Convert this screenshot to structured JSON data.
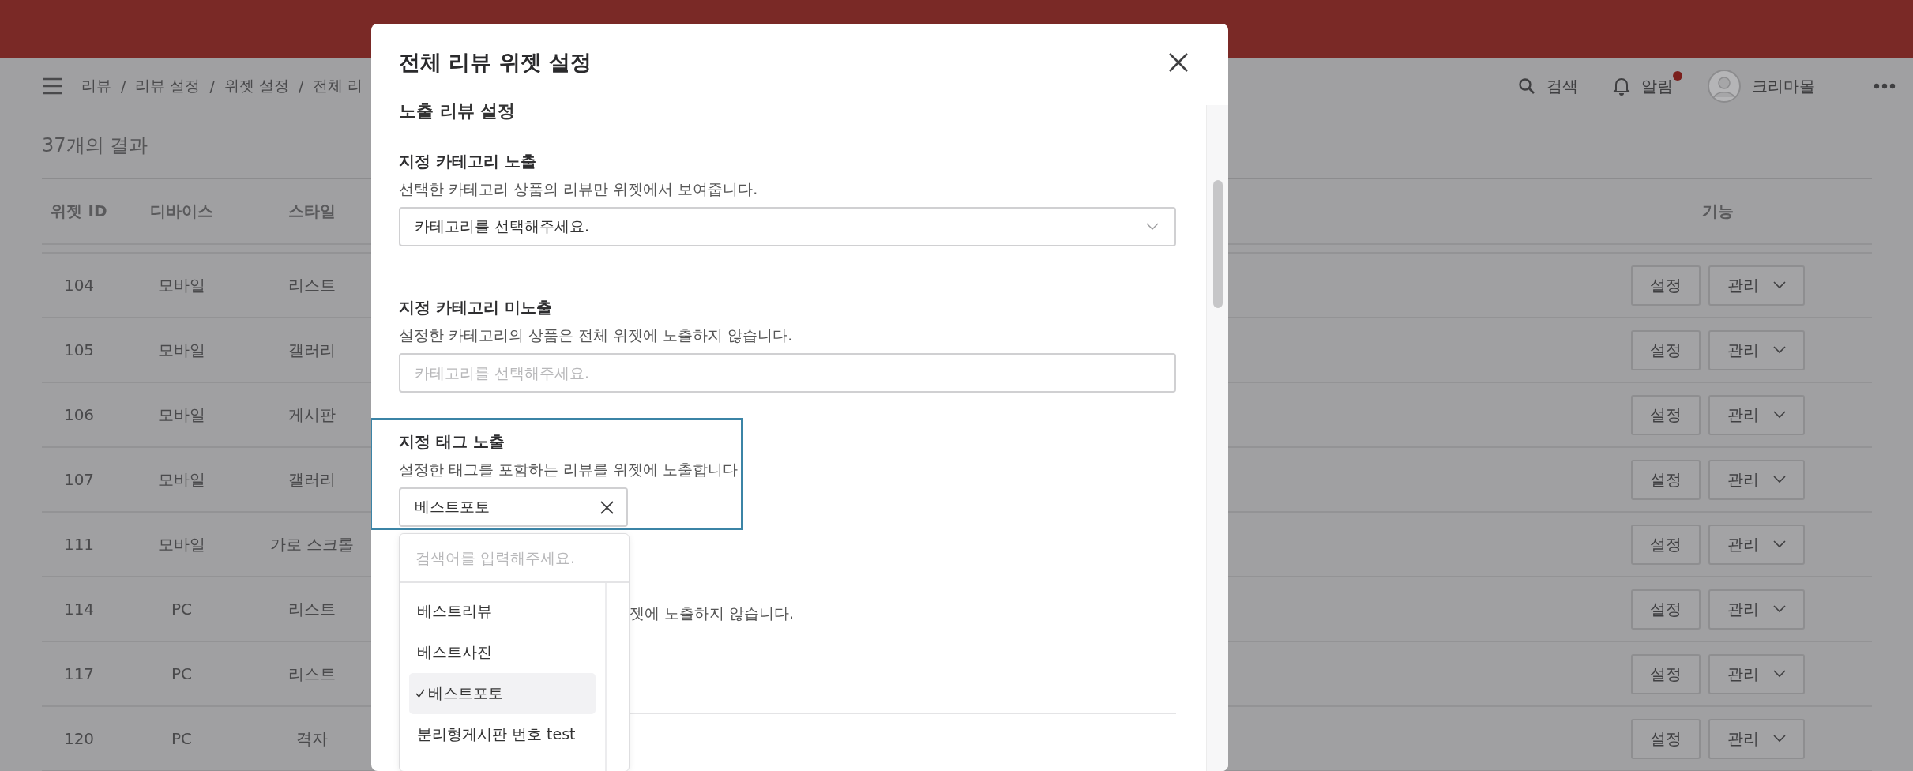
{
  "header": {
    "breadcrumb": {
      "items": [
        "리뷰",
        "리뷰 설정",
        "위젯 설정",
        "전체 리"
      ],
      "separator": "/"
    },
    "actions": [
      {
        "kind": "search",
        "label": "검색"
      },
      {
        "kind": "notifications",
        "label": "알림",
        "badge": true
      },
      {
        "kind": "profile",
        "label": "크리마몰"
      },
      {
        "kind": "more"
      }
    ]
  },
  "result_count": "37개의 결과",
  "table": {
    "columns": [
      "위젯 ID",
      "디바이스",
      "스타일",
      "기능"
    ],
    "rows": [
      {
        "cells": [
          "104",
          "모바일",
          "리스트"
        ],
        "actions": [
          "설정",
          "관리"
        ]
      },
      {
        "cells": [
          "105",
          "모바일",
          "갤러리"
        ],
        "actions": [
          "설정",
          "관리"
        ]
      },
      {
        "cells": [
          "106",
          "모바일",
          "게시판"
        ],
        "actions": [
          "설정",
          "관리"
        ]
      },
      {
        "cells": [
          "107",
          "모바일",
          "갤러리"
        ],
        "actions": [
          "설정",
          "관리"
        ]
      },
      {
        "cells": [
          "111",
          "모바일",
          "가로 스크롤"
        ],
        "actions": [
          "설정",
          "관리"
        ]
      },
      {
        "cells": [
          "114",
          "PC",
          "리스트"
        ],
        "actions": [
          "설정",
          "관리"
        ]
      },
      {
        "cells": [
          "117",
          "PC",
          "리스트"
        ],
        "actions": [
          "설정",
          "관리"
        ]
      },
      {
        "cells": [
          "120",
          "PC",
          "격자"
        ],
        "actions": [
          "설정",
          "관리"
        ]
      }
    ]
  },
  "modal": {
    "title": "전체 리뷰 위젯 설정",
    "section_title": "노출 리뷰 설정",
    "fields": [
      {
        "kind": "select",
        "label": "지정 카테고리 노출",
        "description": "선택한 카테고리 상품의 리뷰만 위젯에서 보여줍니다.",
        "value": "카테고리를 선택해주세요.",
        "highlighted": false
      },
      {
        "kind": "input",
        "label": "지정 카테고리 미노출",
        "description": "설정한 카테고리의 상품은 전체 위젯에 노출하지 않습니다.",
        "placeholder": "카테고리를 선택해주세요.",
        "highlighted": false
      },
      {
        "kind": "tags",
        "label": "지정 태그 노출",
        "description": "설정한 태그를 포함하는 리뷰를 위젯에 노출합니다",
        "value": "베스트포토",
        "highlighted": true
      }
    ],
    "covered_description": "젯에 노출하지 않습니다.",
    "dropdown": {
      "placeholder": "검색어를 입력해주세요.",
      "options": [
        {
          "label": "베스트리뷰",
          "selected": false
        },
        {
          "label": "베스트사진",
          "selected": false
        },
        {
          "label": "베스트포토",
          "selected": true
        },
        {
          "label": "분리형게시판 번호 test",
          "selected": false
        }
      ]
    }
  }
}
